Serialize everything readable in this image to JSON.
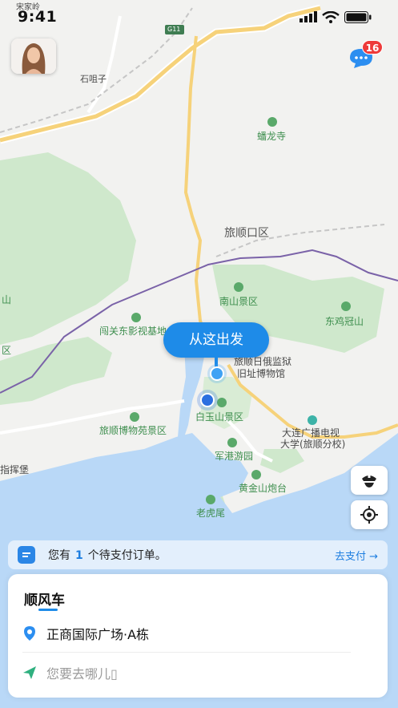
{
  "status_bar": {
    "time": "9:41"
  },
  "header": {
    "unread_count": "16"
  },
  "map": {
    "labels": {
      "songjialing": "宋家岭",
      "g11": "G11",
      "shizuizi": "石咀子",
      "panlongsi": "蟠龙寺",
      "lushunkou": "旅顺口区",
      "nanshan": "南山景区",
      "left_shan": "山",
      "left_qu": "区",
      "chuangguandong": "闯关东影视基地",
      "dongjiguanshan": "东鸡冠山",
      "prison": "旅顺日俄监狱",
      "prison2": "旧址博物馆",
      "museum_park": "旅顺博物苑景区",
      "baiyushan": "白玉山景区",
      "dalian_tv": "大连广播电视",
      "dalian_tv2": "大学(旅顺分校)",
      "junganggyou": "军港游园",
      "zhihuibao": "指挥堡",
      "huangjinshan": "黄金山炮台",
      "laohuwei": "老虎尾"
    },
    "depart_label": "从这出发"
  },
  "notice": {
    "prefix": "您有",
    "count": "1",
    "suffix": "个待支付订单。",
    "link": "去支付 →"
  },
  "card": {
    "tab": "顺风车",
    "origin": "正商国际广场·A栋",
    "destination_placeholder": "您要去哪儿▯"
  },
  "colors": {
    "accent": "#1e8be8",
    "badge": "#ee3a3a",
    "land": "#f2f2f0",
    "water": "#b9d8f7",
    "park": "#cfe8cc"
  }
}
